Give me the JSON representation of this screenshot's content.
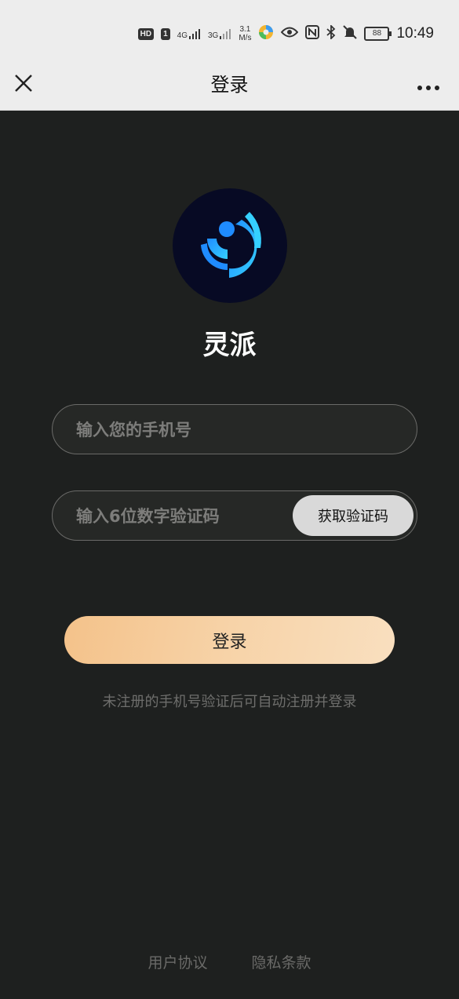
{
  "status_bar": {
    "hd_label": "HD",
    "sim1_label": "1",
    "net1": "4G",
    "net2": "3G",
    "speed_value": "3.1",
    "speed_unit": "M/s",
    "battery": "88",
    "time": "10:49"
  },
  "nav": {
    "title": "登录"
  },
  "app": {
    "name": "灵派"
  },
  "form": {
    "phone_placeholder": "输入您的手机号",
    "phone_value": "",
    "code_placeholder": "输入6位数字验证码",
    "code_value": "",
    "get_code_label": "获取验证码",
    "login_label": "登录",
    "hint": "未注册的手机号验证后可自动注册并登录"
  },
  "footer": {
    "user_agreement": "用户协议",
    "privacy_policy": "隐私条款"
  },
  "colors": {
    "background": "#1e201f",
    "accent": "#f4c28a",
    "logo_bg": "#070a24",
    "logo_blue": "#2aa0ff"
  }
}
